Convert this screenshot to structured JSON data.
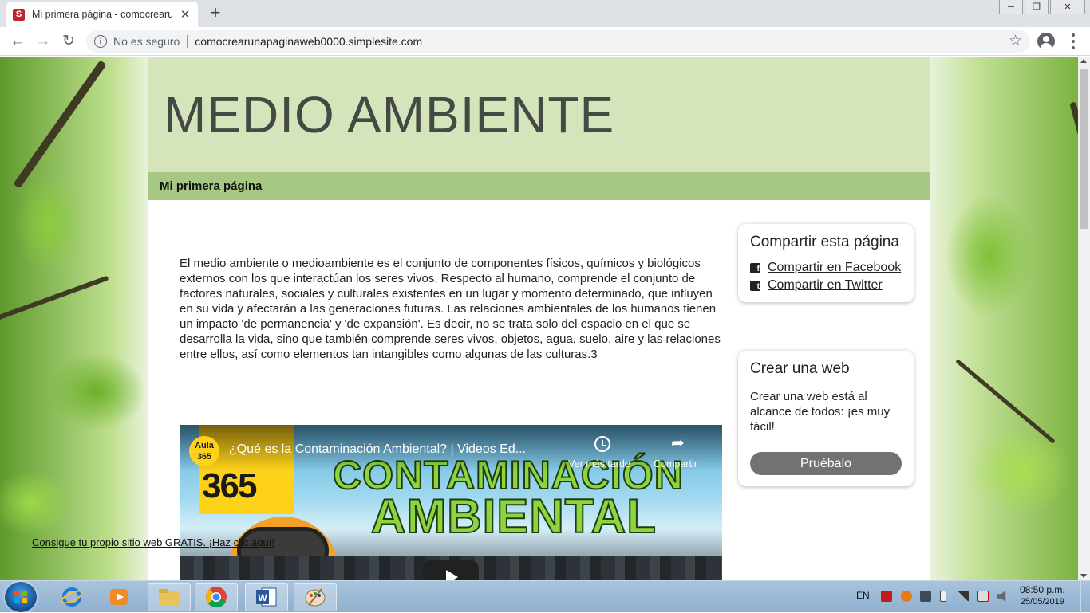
{
  "browser": {
    "tab": {
      "favicon": "S",
      "title": "Mi primera página - comocrearu",
      "close": "✕"
    },
    "new_tab": "+",
    "window_controls": {
      "minimize": "─",
      "restore": "❐",
      "close": "✕"
    },
    "nav": {
      "back": "←",
      "forward": "→",
      "reload": "↻"
    },
    "address": {
      "info": "i",
      "security_label": "No es seguro",
      "url": "comocrearunapaginaweb0000.simplesite.com"
    },
    "bookmark_star": "☆"
  },
  "page": {
    "site_title": "MEDIO AMBIENTE",
    "nav_item": "Mi primera página",
    "body_text": "El medio ambiente o medioambiente es el conjunto de componentes físicos, químicos y biológicos externos con los que interactúan los seres vivos. Respecto al humano, comprende el conjunto de factores naturales, sociales y culturales existentes en un lugar y momento determinado, que influyen en su vida y afectarán a las generaciones futuras. Las relaciones ambientales de los humanos tienen un impacto 'de permanencia' y 'de expansión'. Es decir, no se trata solo del espacio en el que se desarrolla la vida, sino que también comprende seres vivos, objetos, agua, suelo, aire y las relaciones entre ellos, así como elementos tan intangibles como algunas de las culturas.3",
    "video": {
      "channel_logo": "Aula 365",
      "thumb_number": "365",
      "title": "¿Qué es la Contaminación Ambiental? | Videos Ed...",
      "watch_later": "Ver más tarde",
      "share": "Compartir",
      "thumb_line1": "CONTAMINACIÓN",
      "thumb_line2": "AMBIENTAL"
    },
    "share_card": {
      "title": "Compartir esta página",
      "facebook": "Compartir en Facebook",
      "twitter": "Compartir en Twitter",
      "facebook_icon": "f",
      "twitter_icon": "t"
    },
    "create_card": {
      "title": "Crear una web",
      "text": "Crear una web está al alcance de todos: ¡es muy fácil!",
      "button": "Pruébalo"
    },
    "promo_link": "Consigue tu propio sitio web GRATIS. ¡Haz clic aquí!"
  },
  "taskbar": {
    "language": "EN",
    "time": "08:50 p.m.",
    "date": "25/05/2019"
  },
  "colors": {
    "header_bg": "#d6e4bb",
    "nav_bg": "#a7c882",
    "button_bg": "#727272",
    "favicon_red": "#c0272d"
  }
}
